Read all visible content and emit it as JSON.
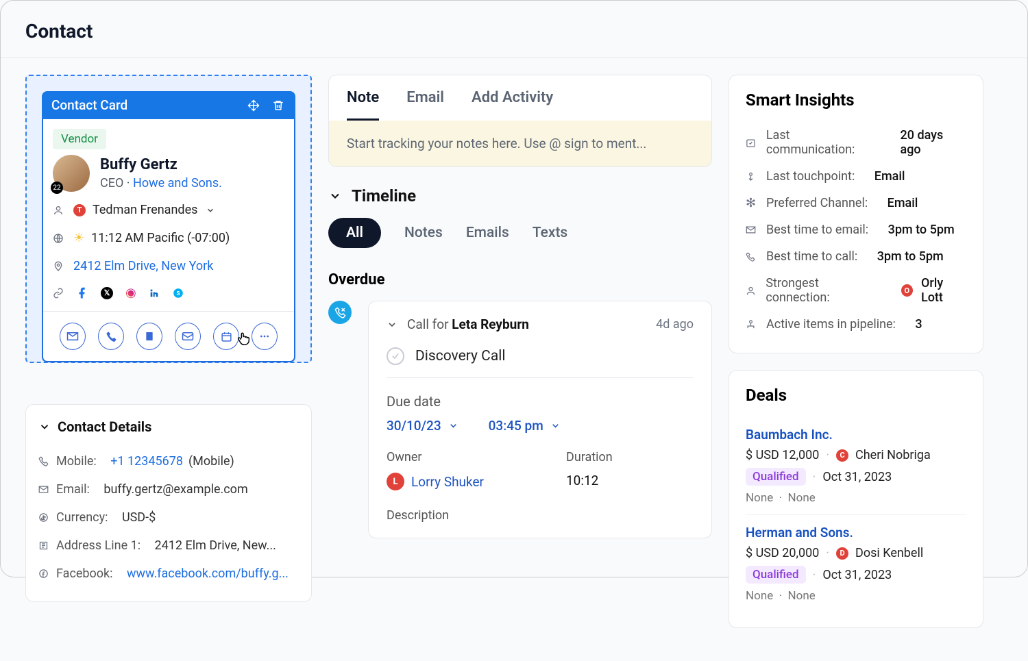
{
  "header": {
    "title": "Contact"
  },
  "contactCard": {
    "toolbarTitle": "Contact Card",
    "tag": "Vendor",
    "name": "Buffy Gertz",
    "role": "CEO",
    "company": "Howe and Sons.",
    "owner": "Tedman Frenandes",
    "ownerBadge": "T",
    "time": "11:12 AM Pacific (-07:00)",
    "address": "2412 Elm Drive, New York"
  },
  "contactDetails": {
    "heading": "Contact Details",
    "mobileLabel": "Mobile:",
    "mobileLink": "+1 12345678",
    "mobileSuffix": " (Mobile)",
    "emailLabel": "Email:",
    "emailValue": "buffy.gertz@example.com",
    "currencyLabel": "Currency:",
    "currencyValue": "USD-$",
    "addrLabel": "Address Line 1:",
    "addrValue": "2412 Elm Drive, New...",
    "fbLabel": "Facebook:",
    "fbValue": "www.facebook.com/buffy.g..."
  },
  "tabs": {
    "note": "Note",
    "email": "Email",
    "add": "Add Activity"
  },
  "notePlaceholder": "Start tracking your notes here. Use @ sign to ment...",
  "timeline": {
    "heading": "Timeline",
    "filterAll": "All",
    "filterNotes": "Notes",
    "filterEmails": "Emails",
    "filterTexts": "Texts",
    "overdue": "Overdue",
    "item": {
      "titlePrefix": "Call for ",
      "titleName": "Leta Reyburn",
      "ago": "4d ago",
      "task": "Discovery Call",
      "dueLabel": "Due date",
      "dueDate": "30/10/23",
      "dueTime": "03:45 pm",
      "ownerLabel": "Owner",
      "ownerBadge": "L",
      "ownerName": "Lorry Shuker",
      "durationLabel": "Duration",
      "durationValue": "10:12",
      "descLabel": "Description"
    }
  },
  "insights": {
    "heading": "Smart Insights",
    "rows": {
      "lastCommLabel": "Last communication:",
      "lastCommVal": "20 days ago",
      "touchLabel": "Last touchpoint:",
      "touchVal": "Email",
      "prefLabel": "Preferred Channel:",
      "prefVal": "Email",
      "emailTimeLabel": "Best time to email:",
      "emailTimeVal": "3pm to 5pm",
      "callTimeLabel": "Best time to call:",
      "callTimeVal": "3pm to 5pm",
      "strongLabel": "Strongest connection:",
      "strongBadge": "O",
      "strongVal": "Orly Lott",
      "pipelineLabel": "Active items in pipeline:",
      "pipelineVal": "3"
    }
  },
  "deals": {
    "heading": "Deals",
    "d1": {
      "name": "Baumbach Inc.",
      "amount": "$ USD 12,000",
      "badge": "C",
      "owner": "Cheri Nobriga",
      "stage": "Qualified",
      "date": "Oct 31, 2023",
      "none1": "None",
      "none2": "None"
    },
    "d2": {
      "name": "Herman and Sons.",
      "amount": "$ USD 20,000",
      "badge": "D",
      "owner": "Dosi Kenbell",
      "stage": "Qualified",
      "date": "Oct 31, 2023",
      "none1": "None",
      "none2": "None"
    }
  }
}
